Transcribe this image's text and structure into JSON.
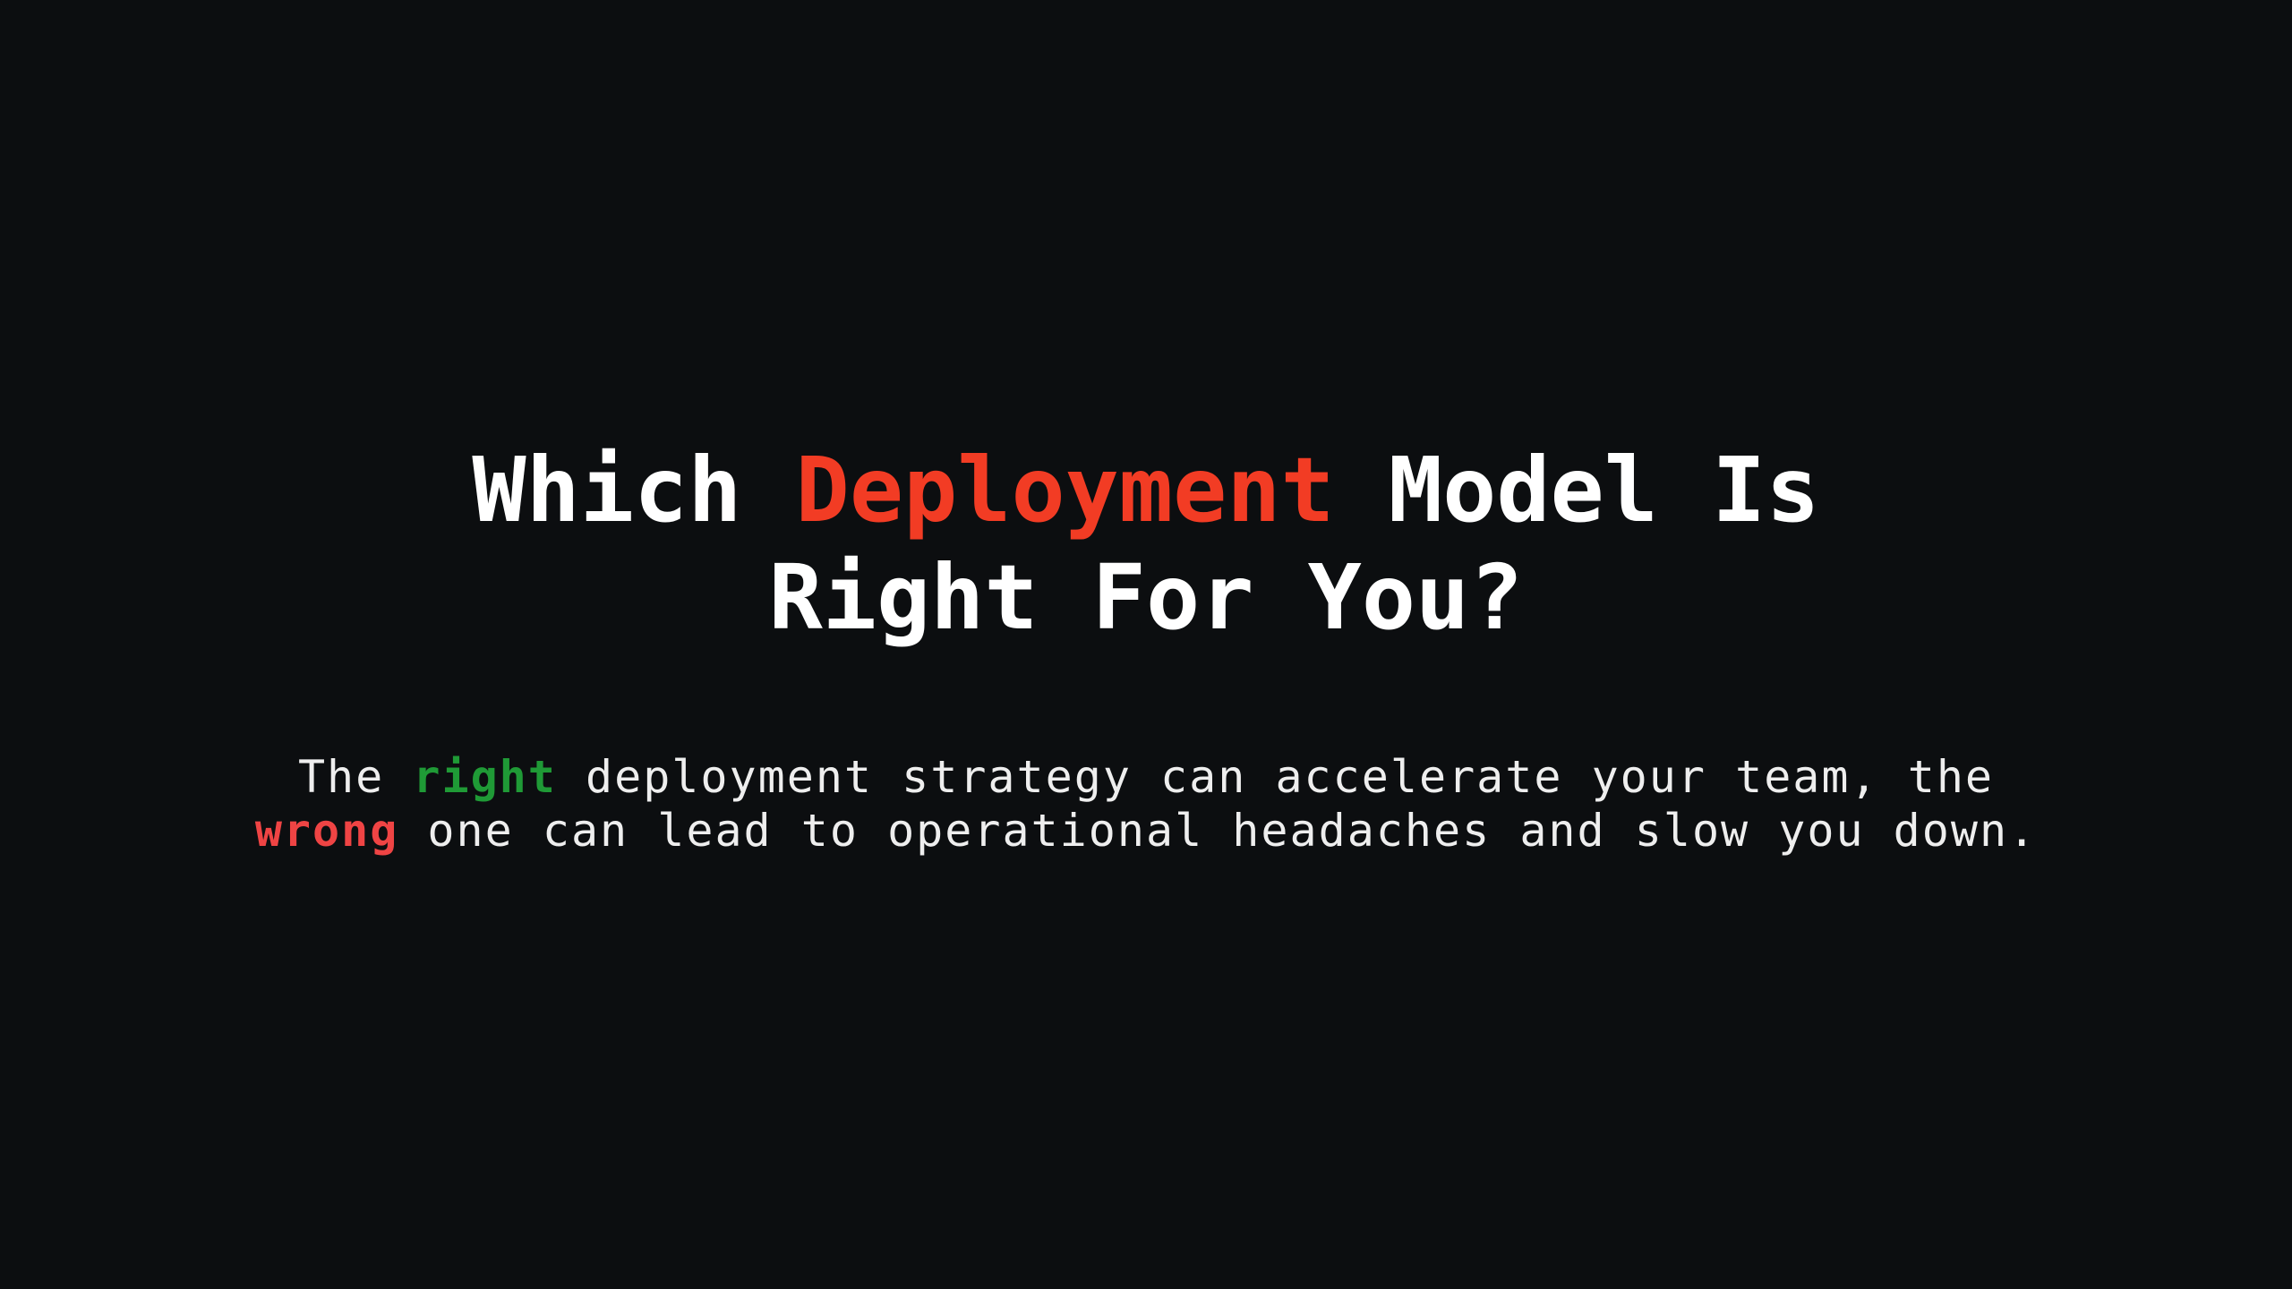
{
  "headline": {
    "line1_before": "Which ",
    "line1_accent": "Deployment",
    "line1_after": " Model Is",
    "line2": "Right For You?"
  },
  "subtitle": {
    "line1_before": "The ",
    "line1_highlight": "right",
    "line1_after": " deployment strategy can accelerate your team, the",
    "line2_highlight": "wrong",
    "line2_after": " one can lead to operational headaches and slow you down."
  },
  "colors": {
    "background": "#0c0e10",
    "headline_text": "#ffffff",
    "headline_accent": "#f23c24",
    "subtitle_text": "#eeeeee",
    "positive_highlight": "#1f9a36",
    "negative_highlight": "#ef4444"
  }
}
